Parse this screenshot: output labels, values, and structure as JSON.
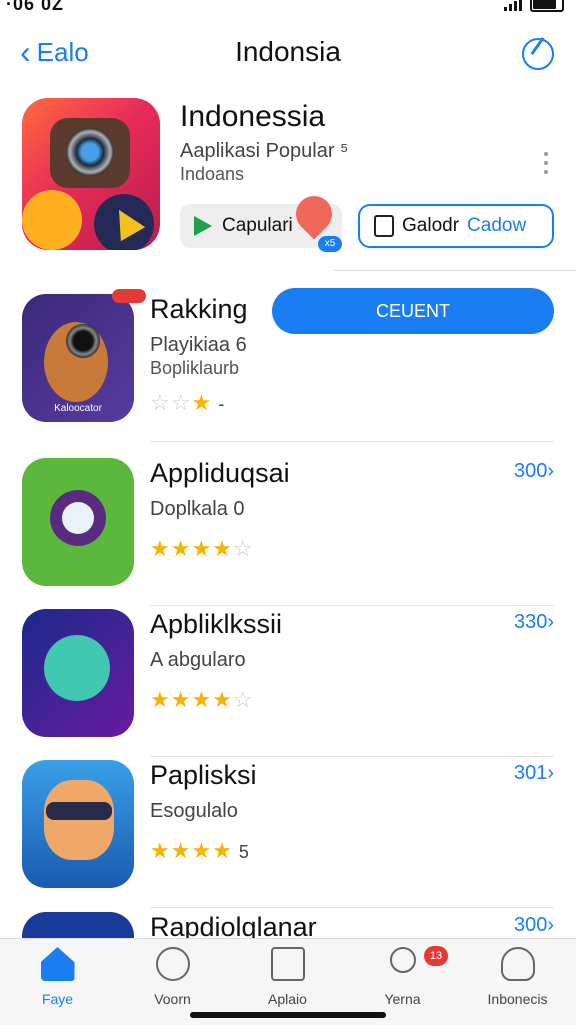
{
  "status": {
    "time": "·06 0Z"
  },
  "nav": {
    "back_label": "Ealo",
    "title": "Indonsia"
  },
  "featured": {
    "title": "Indonessia",
    "subtitle1": "Aaplikasi Popular ⁵",
    "subtitle2": "Indoans",
    "gp_button": "Capulari",
    "pin_badge": "x5",
    "download_button_a": "Galodr",
    "download_button_b": "Cadow"
  },
  "rows": [
    {
      "name": "Rakking",
      "sub": "Playikiaa 6",
      "sub2": "Bopliklaurb",
      "stars_on": "★",
      "stars_off": "☆☆",
      "rating": "-",
      "rank": "",
      "icon_label": "Kaloocator"
    },
    {
      "name": "Appliduqsai",
      "sub": "Doplkala 0",
      "sub2": "",
      "stars_on": "★★★★",
      "stars_off": "☆",
      "rating": "",
      "rank": "300›"
    },
    {
      "name": "Apbliklkssii",
      "sub": "A abgularo",
      "sub2": "",
      "stars_on": "★★★★",
      "stars_off": "☆",
      "rating": "",
      "rank": "330›"
    },
    {
      "name": "Paplisksi",
      "sub": "Esogulalo",
      "sub2": "",
      "stars_on": "★★★★",
      "stars_off": "",
      "rating": "5",
      "rank": "301›"
    },
    {
      "name": "Rapdiolqlanar",
      "sub": "",
      "sub2": "",
      "stars_on": "",
      "stars_off": "",
      "rating": "",
      "rank": "300›"
    }
  ],
  "client_button": "CEUENT",
  "tabs": [
    {
      "label": "Faye",
      "icon": "home-icon"
    },
    {
      "label": "Voorn",
      "icon": "games-icon"
    },
    {
      "label": "Aplaio",
      "icon": "apps-icon"
    },
    {
      "label": "Yerna",
      "icon": "search-icon",
      "badge": "13"
    },
    {
      "label": "Inbonecis",
      "icon": "profile-icon"
    }
  ],
  "colors": {
    "accent": "#1a7ef2",
    "star": "#f5b400",
    "badge": "#e53935"
  }
}
